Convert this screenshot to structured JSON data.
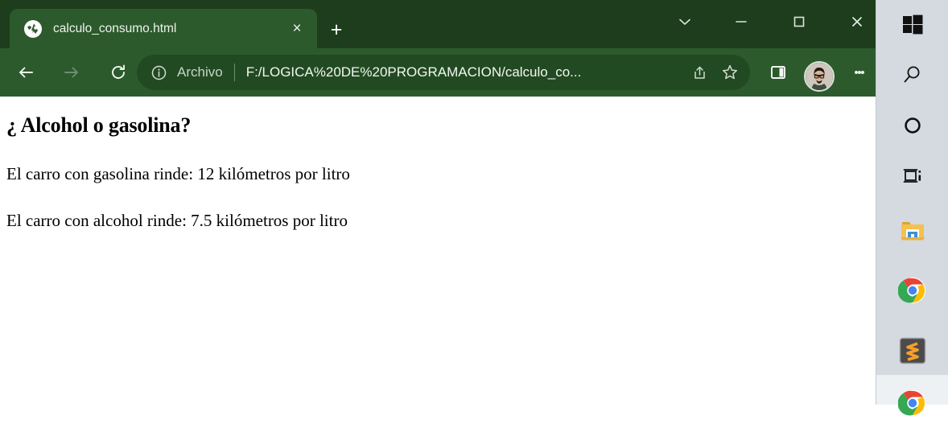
{
  "browser": {
    "tab": {
      "title": "calculo_consumo.html",
      "favicon": "globe-icon",
      "close_label": "×"
    },
    "new_tab_label": "+",
    "window_controls": {
      "tab_search": "chevron-down-icon",
      "minimize": "minimize-icon",
      "maximize": "maximize-icon",
      "close": "close-icon"
    },
    "toolbar": {
      "back": "back-arrow-icon",
      "forward": "forward-arrow-icon",
      "reload": "reload-icon"
    },
    "omnibox": {
      "site_info_icon": "info-circle-icon",
      "scheme_label": "Archivo",
      "url": "F:/LOGICA%20DE%20PROGRAMACION/calculo_co...",
      "share_icon": "share-icon",
      "bookmark_icon": "star-icon"
    },
    "side_panel_icon": "side-panel-icon",
    "profile_icon": "profile-avatar",
    "menu_icon": "three-dots-menu-icon",
    "colors": {
      "title_bar": "#1d3d1d",
      "toolbar": "#2c5a2c",
      "active_tab": "#2c5a2c",
      "omnibox": "#224a22"
    }
  },
  "page": {
    "heading": "¿ Alcohol o gasolina?",
    "paragraphs": [
      "El carro con gasolina rinde: 12 kilómetros por litro",
      "El carro con alcohol rinde: 7.5 kilómetros por litro"
    ]
  },
  "taskbar": {
    "items": [
      {
        "name": "start-button",
        "icon": "windows-logo-icon"
      },
      {
        "name": "search-button",
        "icon": "search-icon"
      },
      {
        "name": "cortana-button",
        "icon": "cortana-circle-icon"
      },
      {
        "name": "task-view-button",
        "icon": "task-view-icon"
      },
      {
        "name": "file-explorer-button",
        "icon": "folder-icon"
      },
      {
        "name": "chrome-button",
        "icon": "chrome-icon"
      },
      {
        "name": "sublime-text-button",
        "icon": "sublime-text-icon"
      },
      {
        "name": "chrome-window-button",
        "icon": "chrome-icon"
      }
    ],
    "background": "#d4dae0"
  }
}
